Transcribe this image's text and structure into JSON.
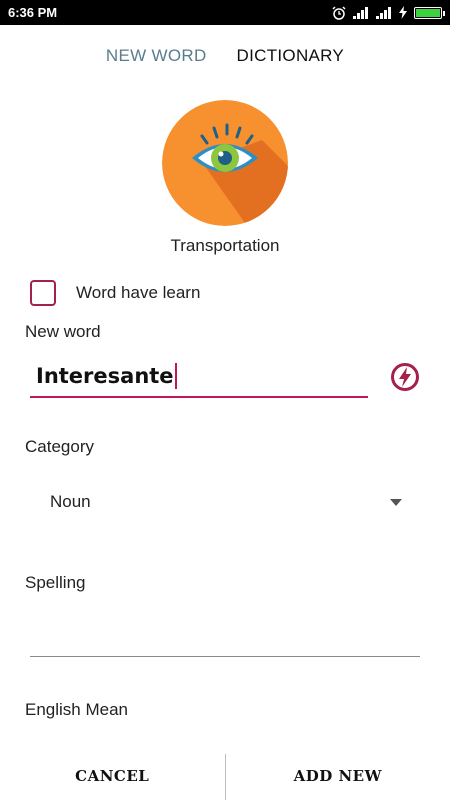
{
  "status_bar": {
    "time": "6:36 PM",
    "battery_level": 1.0
  },
  "tabs": [
    {
      "label": "NEW WORD",
      "active": true
    },
    {
      "label": "DICTIONARY",
      "active": false
    }
  ],
  "category_icon": {
    "icon": "eye-icon",
    "label": "Transportation",
    "colors": {
      "circle": "#f7912f",
      "shadow": "#e06d1f",
      "iris": "#2b8fc6",
      "lashes": "#1f5f88"
    }
  },
  "learned_checkbox": {
    "label": "Word have learn",
    "checked": false
  },
  "new_word": {
    "label": "New word",
    "value": "Interesante"
  },
  "category": {
    "label": "Category",
    "selected": "Noun"
  },
  "spelling": {
    "label": "Spelling",
    "value": ""
  },
  "english_mean": {
    "label": "English Mean"
  },
  "buttons": {
    "cancel": "CANCEL",
    "add_new": "ADD NEW"
  },
  "colors": {
    "accent": "#c2185b",
    "tab_active": "#5b7c8c"
  }
}
